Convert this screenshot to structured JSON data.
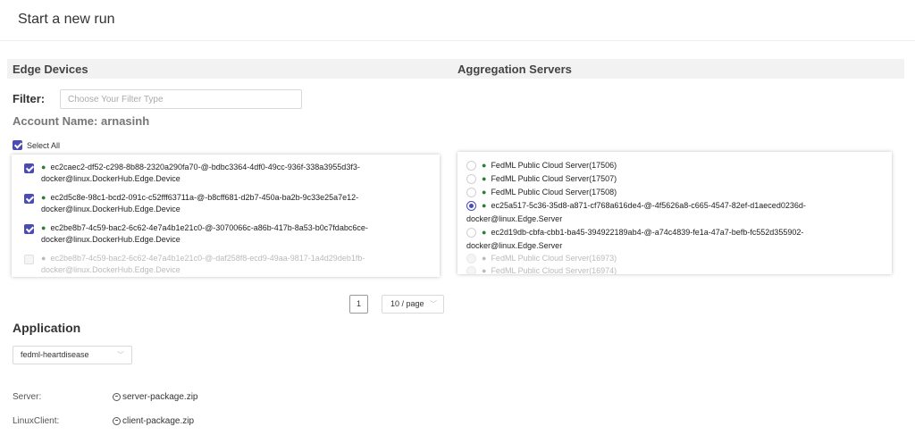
{
  "header": {
    "title": "Start a new run"
  },
  "edge": {
    "heading": "Edge Devices",
    "filter_label": "Filter:",
    "filter_placeholder": "Choose Your Filter Type",
    "account": "Account Name: arnasinh",
    "select_all": "Select All",
    "devices": [
      {
        "text": "ec2caec2-df52-c298-8b88-2320a290fa70-@-bdbc3364-4df0-49cc-936f-338a3955d3f3-docker@linux.DockerHub.Edge.Device",
        "checked": true,
        "disabled": false
      },
      {
        "text": "ec2d5c8e-98c1-bcd2-091c-c52fff63711a-@-b8cff681-d2b7-450a-ba2b-9c33e25a7e12-docker@linux.DockerHub.Edge.Device",
        "checked": true,
        "disabled": false
      },
      {
        "text": "ec2be8b7-4c59-bac2-6c62-4e7a4b1e21c0-@-3070066c-a86b-417b-8a53-b0c7fdabc6ce-docker@linux.DockerHub.Edge.Device",
        "checked": true,
        "disabled": false
      },
      {
        "text": "ec2be8b7-4c59-bac2-6c62-4e7a4b1e21c0-@-daf258f8-ecd9-49aa-9817-1a4d29deb1fb-docker@linux.DockerHub.Edge.Device",
        "checked": false,
        "disabled": true
      }
    ]
  },
  "aggregation": {
    "heading": "Aggregation Servers",
    "servers": [
      {
        "text": "FedML Public Cloud Server(17506)",
        "selected": false,
        "disabled": false
      },
      {
        "text": "FedML Public Cloud Server(17507)",
        "selected": false,
        "disabled": false
      },
      {
        "text": "FedML Public Cloud Server(17508)",
        "selected": false,
        "disabled": false
      },
      {
        "text": "ec25a517-5c36-35d8-a871-cf768a616de4-@-4f5626a8-c665-4547-82ef-d1aeced0236d-docker@linux.Edge.Server",
        "selected": true,
        "disabled": false
      },
      {
        "text": "ec2d19db-cbfa-cbb1-ba45-394922189ab4-@-a74c4839-fe1a-47a7-befb-fc552d355902-docker@linux.Edge.Server",
        "selected": false,
        "disabled": false
      },
      {
        "text": "FedML Public Cloud Server(16973)",
        "selected": false,
        "disabled": true
      },
      {
        "text": "FedML Public Cloud Server(16974)",
        "selected": false,
        "disabled": true
      }
    ]
  },
  "pagination": {
    "page": "1",
    "page_size": "10 / page"
  },
  "application": {
    "heading": "Application",
    "selected": "fedml-heartdisease",
    "server_label": "Server:",
    "server_package": "server-package.zip",
    "client_label": "LinuxClient:",
    "client_package": "client-package.zip"
  },
  "colors": {
    "accent": "#4b4bb5",
    "online_dot": "#2e7d32"
  }
}
